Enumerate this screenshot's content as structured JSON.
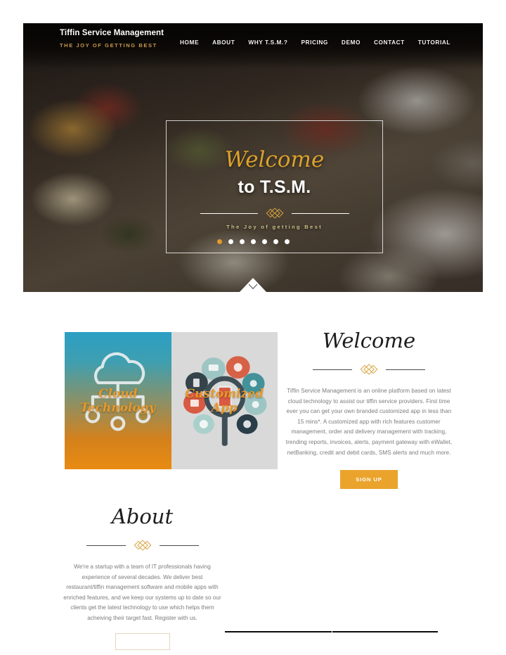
{
  "brand": {
    "title": "Tiffin Service Management",
    "tagline": "THE JOY OF GETTING BEST"
  },
  "nav": {
    "items": [
      {
        "label": "HOME"
      },
      {
        "label": "ABOUT"
      },
      {
        "label": "WHY T.S.M.?"
      },
      {
        "label": "PRICING"
      },
      {
        "label": "DEMO"
      },
      {
        "label": "CONTACT"
      },
      {
        "label": "TUTORIAL"
      }
    ]
  },
  "hero": {
    "script_title": "Welcome",
    "subtitle": "to T.S.M.",
    "tagline": "The Joy of getting Best",
    "scroll_icon": "chevron-down-icon",
    "carousel": {
      "total": 7,
      "active_index": 0,
      "active_color": "#e39a26",
      "inactive_color": "#ffffff"
    }
  },
  "welcome": {
    "heading": "Welcome",
    "paragraph": "Tiffin Service Management is an online platform based on latest cloud technology to assist our tiffin service providers. First time ever you can get your own branded customized app in less than 15 mins*. A customized app with rich features customer management, order and delivery management with tracking, trending reports, invoices, alerts, payment gateway with eWallet, netBanking, credit and debit cards, SMS alerts and much more.",
    "signup_label": "SIGN UP",
    "signup_color": "#eaa42c",
    "media": {
      "left": {
        "caption": "Cloud Technology",
        "icon": "cloud-network-icon"
      },
      "right": {
        "caption": "Customized App",
        "icon": "magnifier-apps-icon"
      }
    }
  },
  "about": {
    "heading": "About",
    "paragraph": "We're a startup with a team of IT professionals having experience of several decades. We deliver best restaurant/tiffin management software and mobile apps with enriched features, and we keep our systems up to date so our clients get the latest technology to use which helps them acheiving their target fast. Register with us.",
    "button_label": ""
  },
  "accent": {
    "gold": "#d8a441",
    "orange": "#eaa42c",
    "script_gold": "#dca12c"
  }
}
